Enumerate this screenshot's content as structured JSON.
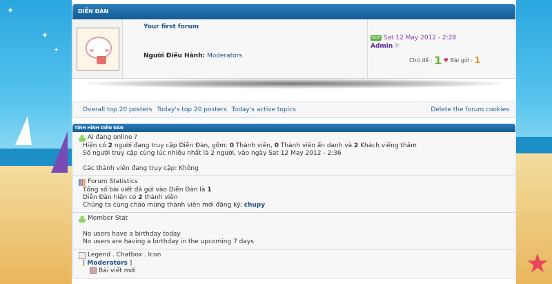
{
  "category": {
    "title": "DIỄN ĐÀN"
  },
  "forum": {
    "title": "Your first forum",
    "moderators_label": "Người Điều Hành:",
    "moderators_value": "Moderators",
    "last_post": {
      "badge": "NEW",
      "date": "Sat 12 May 2012 - 2:28",
      "user": "Admin",
      "goto_icon": "goto-post-icon"
    },
    "topics_label": "Chủ đề :",
    "topics_count": "1",
    "posts_label": "Bài gửi :",
    "posts_count": "1"
  },
  "links": {
    "overall": "Overall top 20 posters",
    "today": "Today's top 20 posters",
    "active": "Today's active topics",
    "delete": "Delete the forum cookies"
  },
  "stats_section": {
    "title": "TÌNH HÌNH DIỄN ĐÀN",
    "online": {
      "header": "Ai đang online ?",
      "line1_a": "Hiện có ",
      "line1_b": "2",
      "line1_c": " người đang truy cập Diễn Đàn, gồm: ",
      "line1_d": "0",
      "line1_e": " Thành viên, ",
      "line1_f": "0",
      "line1_g": " Thành viên ẩn danh và ",
      "line1_h": "2",
      "line1_i": " Khách viếng thăm",
      "line2": "Số người truy cập cùng lúc nhiều nhất là 2 người, vào ngày Sat 12 May 2012 - 2:36",
      "line3": "Các thành viên đang truy cập: Không"
    },
    "forum_stats": {
      "header": "Forum Statistics",
      "line1_a": "Tổng số bài viết đã gửi vào Diễn Đàn là ",
      "line1_b": "1",
      "line2_a": "Diễn Đàn hiện có ",
      "line2_b": "2",
      "line2_c": " thành viên",
      "line3_a": "Chúng ta cùng chào mừng thành viên mới đăng ký: ",
      "line3_b": "chupy"
    },
    "member_stat": {
      "header": "Member Stat",
      "line1": "No users have a birthday today",
      "line2": "No users are having a birthday in the upcoming 7 days"
    },
    "legend": {
      "header": "Legend . Chatbox . Icon",
      "bracket_open": "[",
      "mod": "Moderators",
      "bracket_close": "]",
      "new_post": "Bài viết mới"
    }
  },
  "colors": {
    "header_blue": "#155c94",
    "link": "#1f5fa0",
    "date_purple": "#8a3ab0",
    "count_green": "#69b52e"
  }
}
